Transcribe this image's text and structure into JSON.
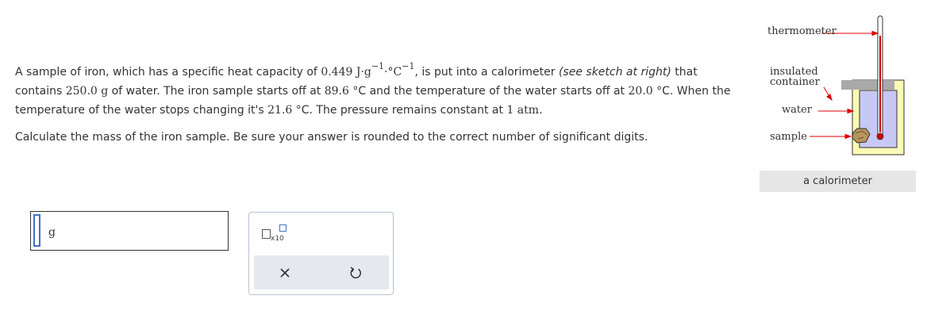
{
  "question": {
    "l1_a": "A sample of iron, which has a specific heat capacity of ",
    "l1_val": "0.449",
    "l1_unit_j": "J·g",
    "l1_exp1": "−1",
    "l1_dot": "·°C",
    "l1_exp2": "−1",
    "l1_b": ", is put into a calorimeter ",
    "l1_em": "(see sketch at right)",
    "l1_c": " that",
    "l2_a": "contains ",
    "l2_mass": "250.0",
    "l2_g": "g",
    "l2_b": " of water. The iron sample starts off at ",
    "l2_t1": "89.6",
    "l2_c": " °C and the temperature of the water starts off at ",
    "l2_t2": "20.0",
    "l2_d": " °C. When the",
    "l3_a": "temperature of the water stops changing it's ",
    "l3_t": "21.6",
    "l3_b": " °C. The pressure remains constant at ",
    "l3_p": "1 atm",
    "l3_c": ".",
    "l4": "Calculate the mass of the iron sample. Be sure your answer is rounded to the correct number of significant digits."
  },
  "answer": {
    "value": "",
    "unit": "g"
  },
  "toolbox": {
    "x10_label": "x10",
    "clear_icon": "close-icon",
    "reset_icon": "undo-icon"
  },
  "diagram": {
    "thermometer": "thermometer",
    "insulated_1": "insulated",
    "insulated_2": "container",
    "water": "water",
    "sample": "sample",
    "caption": "a calorimeter",
    "colors": {
      "water": "#c8c8f5",
      "container": "#fafab4",
      "lid": "#a9a9a9",
      "arrow": "#e00000",
      "input_border": "#3d72c4"
    }
  }
}
